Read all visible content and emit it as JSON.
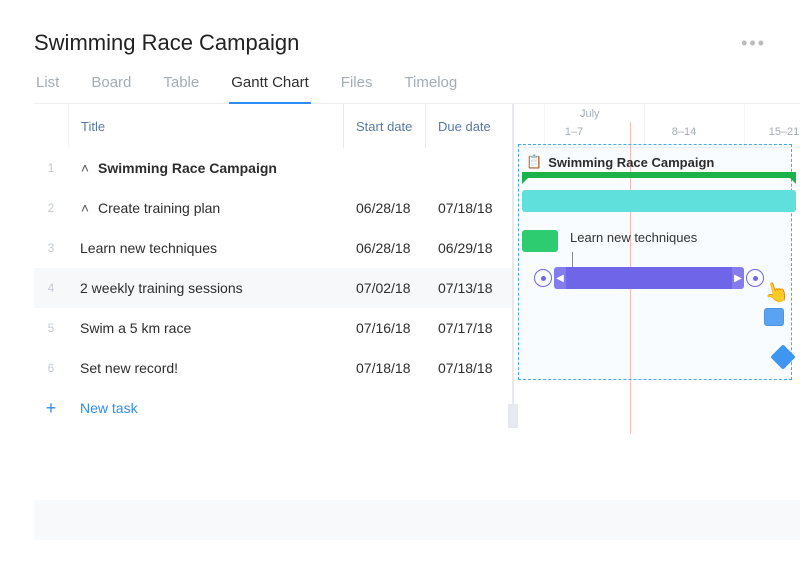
{
  "header": {
    "title": "Swimming Race Campaign",
    "more_icon": "•••"
  },
  "tabs": {
    "items": [
      "List",
      "Board",
      "Table",
      "Gantt Chart",
      "Files",
      "Timelog"
    ],
    "active_index": 3
  },
  "columns": {
    "title": "Title",
    "start": "Start date",
    "due": "Due date"
  },
  "rows": [
    {
      "num": "1",
      "indent": 0,
      "chev": "˄",
      "bold": true,
      "title": "Swimming Race Campaign",
      "start": "",
      "due": ""
    },
    {
      "num": "2",
      "indent": 1,
      "chev": "˄",
      "bold": false,
      "title": "Create training plan",
      "start": "06/28/18",
      "due": "07/18/18"
    },
    {
      "num": "3",
      "indent": 2,
      "chev": "",
      "bold": false,
      "title": "Learn new techniques",
      "start": "06/28/18",
      "due": "06/29/18"
    },
    {
      "num": "4",
      "indent": 2,
      "chev": "",
      "bold": false,
      "title": "2 weekly training sessions",
      "start": "07/02/18",
      "due": "07/13/18",
      "hl": true
    },
    {
      "num": "5",
      "indent": 2,
      "chev": "",
      "bold": false,
      "title": "Swim a 5 km race",
      "start": "07/16/18",
      "due": "07/17/18"
    },
    {
      "num": "6",
      "indent": 2,
      "chev": "",
      "bold": false,
      "title": "Set new record!",
      "start": "07/18/18",
      "due": "07/18/18"
    }
  ],
  "new_task": {
    "plus": "+",
    "label": "New task"
  },
  "gantt": {
    "month": "July",
    "ranges": [
      "1–7",
      "8–14",
      "15–21"
    ],
    "project_label": "Swimming Race Campaign",
    "bar_label_learn": "Learn new techniques"
  }
}
